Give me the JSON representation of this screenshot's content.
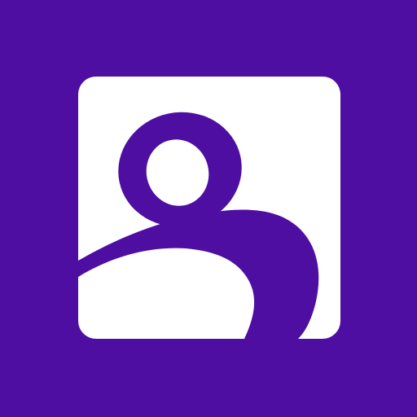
{
  "app_icon": {
    "icon_name": "user-profile-icon",
    "colors": {
      "background": "#4e0ea2",
      "tile": "#ffffff",
      "figure": "#4e0ea2"
    }
  }
}
